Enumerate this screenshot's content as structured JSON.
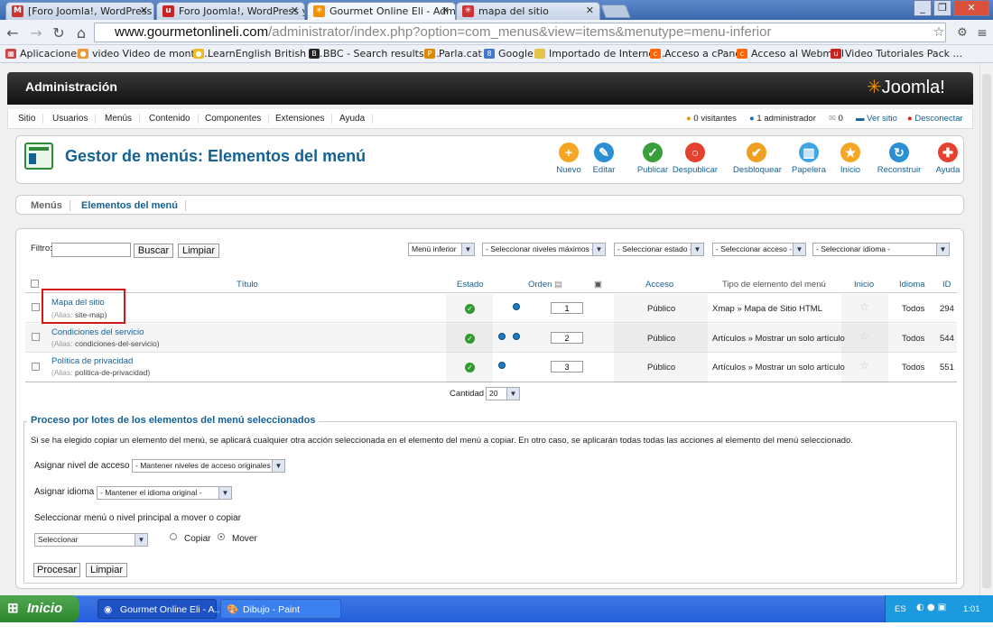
{
  "browser": {
    "tabs": [
      {
        "label": "[Foro Joomla!, WordPress y",
        "icon": "gmail-icon"
      },
      {
        "label": "Foro Joomla!, WordPress y P",
        "icon": "forum-icon"
      },
      {
        "label": "Gourmet Online Eli - Administ",
        "icon": "joomla-icon"
      },
      {
        "label": "mapa del sitio",
        "icon": "joomla-icon"
      }
    ],
    "url_host": "www.gourmetonlineli.com",
    "url_path": "/administrator/index.php?option=com_menus&view=items&menutype=menu-inferior",
    "bookmarks": [
      "Aplicaciones",
      "video Video de monta...",
      "LearnEnglish British C...",
      "BBC - Search results f...",
      "Parla.cat",
      "Google",
      "Importado de Internet...",
      "Acceso a cPanel",
      "Acceso al Webmail",
      "Video Tutoriales Pack ..."
    ]
  },
  "joomla": {
    "header_title": "Administración",
    "logo_text": "Joomla!",
    "menu": [
      "Sitio",
      "Usuarios",
      "Menús",
      "Contenido",
      "Componentes",
      "Extensiones",
      "Ayuda"
    ],
    "status": {
      "visitors": "0 visitantes",
      "admins": "1 administrador",
      "messages": "0",
      "view_site": "Ver sitio",
      "logout": "Desconectar"
    },
    "page_title": "Gestor de menús: Elementos del menú",
    "toolbar": [
      {
        "label": "Nuevo",
        "icon": "plus-icon",
        "color": "#f5a623"
      },
      {
        "label": "Editar",
        "icon": "pencil-icon",
        "color": "#2b8fd6"
      },
      {
        "label": "Publicar",
        "icon": "check-icon",
        "color": "#3a9e3a"
      },
      {
        "label": "Despublicar",
        "icon": "unpublish-icon",
        "color": "#e4422e"
      },
      {
        "label": "Desbloquear",
        "icon": "checkin-icon",
        "color": "#f0a020"
      },
      {
        "label": "Papelera",
        "icon": "trash-icon",
        "color": "#3da6e3"
      },
      {
        "label": "Inicio",
        "icon": "star-icon",
        "color": "#f5a623"
      },
      {
        "label": "Reconstruir",
        "icon": "refresh-icon",
        "color": "#2b8fd6"
      },
      {
        "label": "Ayuda",
        "icon": "help-icon",
        "color": "#e4422e"
      }
    ],
    "submenu": [
      "Menús",
      "Elementos del menú"
    ],
    "filter": {
      "label": "Filtro:",
      "value": "",
      "search": "Buscar",
      "clear": "Limpiar"
    },
    "selects": [
      "Menú inferior",
      "- Seleccionar niveles máximos -",
      "- Seleccionar estado -",
      "- Seleccionar acceso -",
      "- Seleccionar idioma -"
    ],
    "columns": {
      "title": "Título",
      "status": "Estado",
      "order": "Orden",
      "access": "Acceso",
      "type": "Tipo de elemento del menú",
      "home": "Inicio",
      "language": "Idioma",
      "id": "ID"
    },
    "rows": [
      {
        "title": "Mapa del sitio",
        "alias_label": "(Alias:",
        "alias": "site-map)",
        "order": "1",
        "access": "Público",
        "type": "Xmap » Mapa de Sitio HTML",
        "language": "Todos",
        "id": "294"
      },
      {
        "title": "Condiciones del servicio",
        "alias_label": "(Alias:",
        "alias": "condiciones-del-servicio)",
        "order": "2",
        "access": "Público",
        "type": "Artículos » Mostrar un solo artículo",
        "language": "Todos",
        "id": "544"
      },
      {
        "title": "Política de privacidad",
        "alias_label": "(Alias:",
        "alias": "politica-de-privacidad)",
        "order": "3",
        "access": "Público",
        "type": "Artículos » Mostrar un solo artículo",
        "language": "Todos",
        "id": "551"
      }
    ],
    "limit": {
      "label": "Cantidad",
      "value": "20"
    },
    "batch": {
      "legend": "Proceso por lotes de los elementos del menú seleccionados",
      "text": "Si se ha elegido copiar un elemento del menú, se aplicará cualquier otra acción seleccionada en el elemento del menú a copiar. En otro caso, se aplicarán todas todas las acciones al elemento del menú seleccionado.",
      "access_label": "Asignar nivel de acceso",
      "access_value": "- Mantener niveles de acceso originales -",
      "lang_label": "Asignar idioma",
      "lang_value": "- Mantener el idioma original -",
      "move_label": "Seleccionar menú o nivel principal a mover o copiar",
      "move_value": "Seleccionar",
      "copy": "Copiar",
      "move": "Mover",
      "process": "Procesar",
      "clear": "Limpiar"
    }
  },
  "taskbar": {
    "start": "Inicio",
    "tasks": [
      "Gourmet Online Eli - A...",
      "Dibujo - Paint"
    ],
    "lang": "ES",
    "time": "1:01"
  }
}
